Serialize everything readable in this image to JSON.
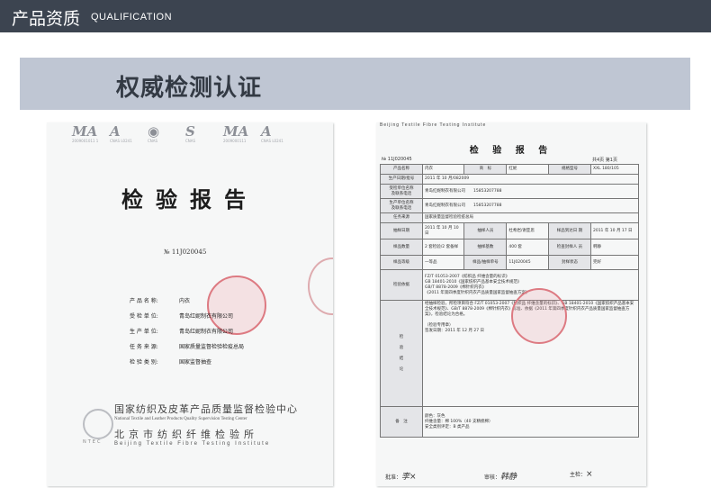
{
  "header": {
    "title_cn": "产品资质",
    "title_en": "QUALIFICATION"
  },
  "banner": {
    "title": "权威检测认证"
  },
  "doc_left": {
    "logos": [
      {
        "mark": "MA",
        "text": "2009001011 1"
      },
      {
        "mark": "A",
        "text": "CNAS L0241"
      },
      {
        "mark": "◉",
        "text": "CNAS"
      },
      {
        "mark": "S",
        "text": "CNAS"
      },
      {
        "mark": "MA",
        "text": "2009000111"
      },
      {
        "mark": "A",
        "text": "CNAS L0241"
      }
    ],
    "title": "检验报告",
    "report_no": "№ 11J020045",
    "fields": [
      {
        "label": "产 品 名 称:",
        "value": "内衣"
      },
      {
        "label": "受 检 单 位:",
        "value": "青岛红妮制衣有限公司"
      },
      {
        "label": "生 产 单 位:",
        "value": "青岛红妮制衣有限公司"
      },
      {
        "label": "任 务 来 源:",
        "value": "国家质量监督检验检疫总局"
      },
      {
        "label": "检 验 类 别:",
        "value": "国家监督抽查"
      }
    ],
    "institute_cn": "国家纺织及皮革产品质量监督检验中心",
    "institute_en": "National Textile and Leather Products Quality Supervision Testing Center",
    "institute2_cn": "北京市纺织纤维检验所",
    "institute2_en": "Beijing Textile Fibre Testing Institute",
    "ntec": "NTEC"
  },
  "doc_right": {
    "header": "Beijing Textile Fibre Testing Institute",
    "title": "检 验 报 告",
    "report_no": "№ 11J020045",
    "page": "共4页  第1页",
    "rows": [
      {
        "c": [
          "产品名称",
          "内衣",
          "商　标",
          "红妮",
          "规格型号",
          "XXL 180/105"
        ]
      },
      {
        "c": [
          "生产日期/批号",
          "2011 年 10 月/082009"
        ]
      },
      {
        "c": [
          "受检单位名称\n及联系电话",
          "青岛红妮制衣有限公司　　15853207788"
        ]
      },
      {
        "c": [
          "生产单位名称\n及联系电话",
          "青岛红妮制衣有限公司　　15853207788"
        ]
      },
      {
        "c": [
          "任务来源",
          "国家质量监督检验检疫总局"
        ]
      },
      {
        "c": [
          "抽样日期",
          "2011 年 10 月 10日",
          "抽样人员",
          "杜希岩/谢亚思",
          "样品到达日 期",
          "2011 年 10 月 17 日"
        ]
      },
      {
        "c": [
          "样品数量",
          "2 套检验/2 套备样",
          "抽样基数",
          "400 套",
          "检查封样人 员",
          "韩静"
        ]
      },
      {
        "c": [
          "样品等级",
          "一等品",
          "样品/抽样单号",
          "11J020045",
          "封样状态",
          "完好"
        ]
      },
      {
        "c": [
          "检验依据",
          "FZ/T 01053-2007《纺织品 纤维含量的标识》\nGB 18401-2010《国家纺织产品基本安全技术规范》\nGB/T 8878-2009《棉针织内衣》\n《2011 年第四季度针织内衣产品质量国家监督抽查方案》"
        ]
      },
      {
        "c": [
          "检\n\n验\n\n结\n\n论",
          "经抽样检验，所检项目符合 FZ/T 01053-2007《纺织品 纤维含量的标识》、GB 18401-2010《国家纺织产品基本安全技术规范》、GB/T 8878-2009《棉针织内衣》标准、依据《2011 年第四季度针织内衣产品质量国家监督抽查方案》，检验结论为合格。\n\n（检验专用章）\n签发日期：2011 年 12 月 27 日"
        ]
      },
      {
        "c": [
          "备　注",
          "颜色：灰色\n纤维含量：棉 100%（40 支精梳棉）\n安全类别评定：B 类产品"
        ]
      }
    ],
    "sign": [
      {
        "label": "批准：",
        "name": "李×"
      },
      {
        "label": "审核：",
        "name": "韩静"
      },
      {
        "label": "主检：",
        "name": "×"
      }
    ]
  }
}
